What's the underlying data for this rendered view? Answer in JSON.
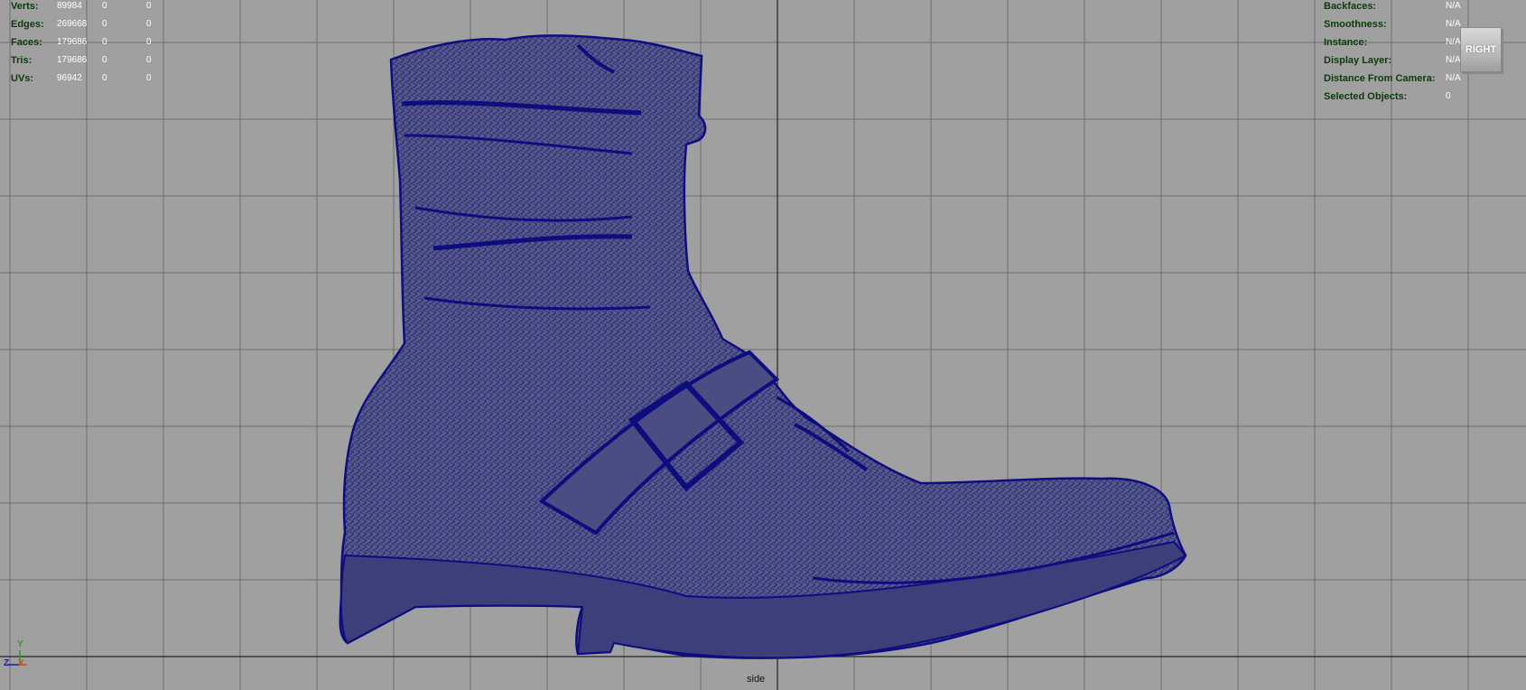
{
  "hud_left": {
    "rows": [
      {
        "label": "Verts:",
        "v1": "89984",
        "v2": "0",
        "v3": "0"
      },
      {
        "label": "Edges:",
        "v1": "269668",
        "v2": "0",
        "v3": "0"
      },
      {
        "label": "Faces:",
        "v1": "179686",
        "v2": "0",
        "v3": "0"
      },
      {
        "label": "Tris:",
        "v1": "179686",
        "v2": "0",
        "v3": "0"
      },
      {
        "label": "UVs:",
        "v1": "96942",
        "v2": "0",
        "v3": "0"
      }
    ]
  },
  "hud_right": {
    "rows": [
      {
        "label": "Backfaces:",
        "value": "N/A"
      },
      {
        "label": "Smoothness:",
        "value": "N/A"
      },
      {
        "label": "Instance:",
        "value": "N/A"
      },
      {
        "label": "Display Layer:",
        "value": "N/A"
      },
      {
        "label": "Distance From Camera:",
        "value": "N/A"
      },
      {
        "label": "Selected Objects:",
        "value": "0"
      }
    ]
  },
  "viewcube": {
    "label": "RIGHT"
  },
  "camera": {
    "name": "side"
  },
  "axis": {
    "y": "Y",
    "z": "Z",
    "x": "X"
  },
  "colors": {
    "background": "#a0a0a0",
    "grid": "#6e6e6e",
    "axis_line": "#222222",
    "wireframe": "#0d0d80",
    "hud_label": "#0a3b0a",
    "hud_value": "#ffffff"
  },
  "model": {
    "name": "boot-mesh"
  }
}
